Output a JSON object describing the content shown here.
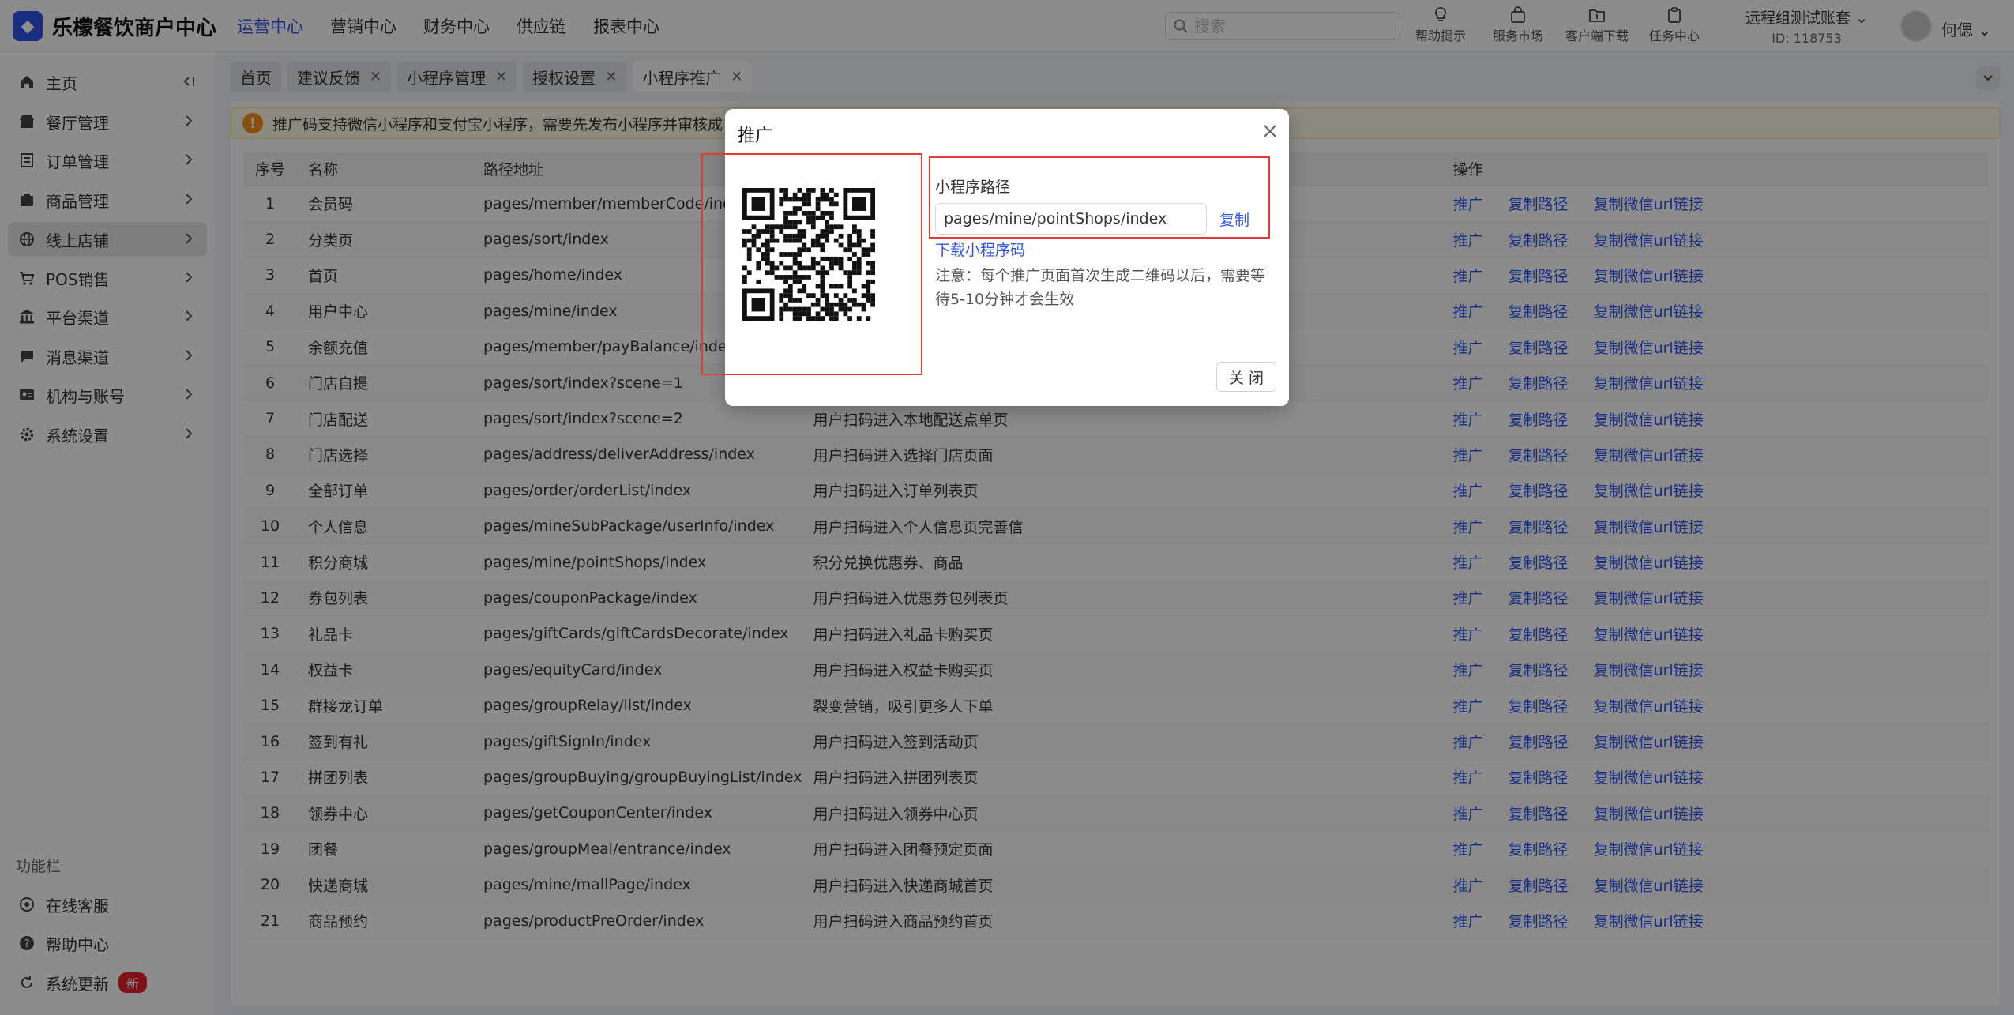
{
  "header": {
    "logo_text": "乐檬餐饮商户中心",
    "nav": [
      "运营中心",
      "营销中心",
      "财务中心",
      "供应链",
      "报表中心"
    ],
    "search_placeholder": "搜索",
    "tools": [
      {
        "label": "帮助提示",
        "icon": "lightbulb-icon"
      },
      {
        "label": "服务市场",
        "icon": "shop-bag-icon"
      },
      {
        "label": "客户端下载",
        "icon": "folder-download-icon"
      },
      {
        "label": "任务中心",
        "icon": "clipboard-icon"
      }
    ],
    "account_name": "远程组测试账套",
    "account_id": "ID: 118753",
    "user_name": "何偲"
  },
  "sidebar": {
    "items": [
      {
        "label": "主页"
      },
      {
        "label": "餐厅管理"
      },
      {
        "label": "订单管理"
      },
      {
        "label": "商品管理"
      },
      {
        "label": "线上店铺"
      },
      {
        "label": "POS销售"
      },
      {
        "label": "平台渠道"
      },
      {
        "label": "消息渠道"
      },
      {
        "label": "机构与账号"
      },
      {
        "label": "系统设置"
      }
    ],
    "section_label": "功能栏",
    "bottom": [
      {
        "label": "在线客服"
      },
      {
        "label": "帮助中心"
      },
      {
        "label": "系统更新",
        "badge": "新"
      }
    ]
  },
  "tabs": [
    {
      "label": "首页"
    },
    {
      "label": "建议反馈"
    },
    {
      "label": "小程序管理"
    },
    {
      "label": "授权设置"
    },
    {
      "label": "小程序推广"
    }
  ],
  "notice": "推广码支持微信小程序和支付宝小程序，需要先发布小程序并审核成",
  "table": {
    "headers": {
      "no": "序号",
      "name": "名称",
      "path": "路径地址",
      "desc": "",
      "ops": "操作"
    },
    "ops": [
      "推广",
      "复制路径",
      "复制微信url链接"
    ],
    "rows": [
      {
        "no": "1",
        "name": "会员码",
        "path": "pages/member/memberCode/index",
        "desc": ""
      },
      {
        "no": "2",
        "name": "分类页",
        "path": "pages/sort/index",
        "desc": ""
      },
      {
        "no": "3",
        "name": "首页",
        "path": "pages/home/index",
        "desc": ""
      },
      {
        "no": "4",
        "name": "用户中心",
        "path": "pages/mine/index",
        "desc": ""
      },
      {
        "no": "5",
        "name": "余额充值",
        "path": "pages/member/payBalance/index",
        "desc": ""
      },
      {
        "no": "6",
        "name": "门店自提",
        "path": "pages/sort/index?scene=1",
        "desc": ""
      },
      {
        "no": "7",
        "name": "门店配送",
        "path": "pages/sort/index?scene=2",
        "desc": "用户扫码进入本地配送点单页"
      },
      {
        "no": "8",
        "name": "门店选择",
        "path": "pages/address/deliverAddress/index",
        "desc": "用户扫码进入选择门店页面"
      },
      {
        "no": "9",
        "name": "全部订单",
        "path": "pages/order/orderList/index",
        "desc": "用户扫码进入订单列表页"
      },
      {
        "no": "10",
        "name": "个人信息",
        "path": "pages/mineSubPackage/userInfo/index",
        "desc": "用户扫码进入个人信息页完善信"
      },
      {
        "no": "11",
        "name": "积分商城",
        "path": "pages/mine/pointShops/index",
        "desc": "积分兑换优惠券、商品"
      },
      {
        "no": "12",
        "name": "券包列表",
        "path": "pages/couponPackage/index",
        "desc": "用户扫码进入优惠券包列表页"
      },
      {
        "no": "13",
        "name": "礼品卡",
        "path": "pages/giftCards/giftCardsDecorate/index",
        "desc": "用户扫码进入礼品卡购买页"
      },
      {
        "no": "14",
        "name": "权益卡",
        "path": "pages/equityCard/index",
        "desc": "用户扫码进入权益卡购买页"
      },
      {
        "no": "15",
        "name": "群接龙订单",
        "path": "pages/groupRelay/list/index",
        "desc": "裂变营销，吸引更多人下单"
      },
      {
        "no": "16",
        "name": "签到有礼",
        "path": "pages/giftSignIn/index",
        "desc": "用户扫码进入签到活动页"
      },
      {
        "no": "17",
        "name": "拼团列表",
        "path": "pages/groupBuying/groupBuyingList/index",
        "desc": "用户扫码进入拼团列表页"
      },
      {
        "no": "18",
        "name": "领券中心",
        "path": "pages/getCouponCenter/index",
        "desc": "用户扫码进入领券中心页"
      },
      {
        "no": "19",
        "name": "团餐",
        "path": "pages/groupMeal/entrance/index",
        "desc": "用户扫码进入团餐预定页面"
      },
      {
        "no": "20",
        "name": "快递商城",
        "path": "pages/mine/mallPage/index",
        "desc": "用户扫码进入快递商城首页"
      },
      {
        "no": "21",
        "name": "商品预约",
        "path": "pages/productPreOrder/index",
        "desc": "用户扫码进入商品预约首页"
      }
    ]
  },
  "modal": {
    "title": "推广",
    "path_label": "小程序路径",
    "path_value": "pages/mine/pointShops/index",
    "copy_label": "复制",
    "download_label": "下载小程序码",
    "note": "注意：每个推广页面首次生成二维码以后，需要等待5-10分钟才会生效",
    "close_label": "关 闭"
  },
  "colors": {
    "accent": "#2f54eb",
    "highlight_border": "#e53935",
    "warning": "#fa8c16",
    "badge": "#e8202a"
  }
}
